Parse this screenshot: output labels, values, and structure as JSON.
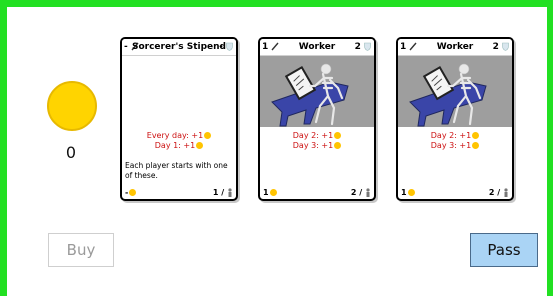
{
  "player": {
    "coins": "0"
  },
  "cards": [
    {
      "left_label": "-",
      "title": "Sorcerer's Stipend",
      "right_label": "-",
      "effects": [
        {
          "text": "Every day: +1"
        },
        {
          "text": "Day 1: +1"
        }
      ],
      "description": "Each player starts with one of these.",
      "cost_label": "-",
      "count": "1 /"
    },
    {
      "left_label": "1",
      "title": "Worker",
      "right_label": "2",
      "effects": [
        {
          "text": "Day 2: +1"
        },
        {
          "text": "Day 3: +1"
        }
      ],
      "description": "",
      "cost_label": "1",
      "count": "2 /"
    },
    {
      "left_label": "1",
      "title": "Worker",
      "right_label": "2",
      "effects": [
        {
          "text": "Day 2: +1"
        },
        {
          "text": "Day 3: +1"
        }
      ],
      "description": "",
      "cost_label": "1",
      "count": "2 /"
    }
  ],
  "buttons": {
    "buy": "Buy",
    "pass": "Pass"
  },
  "colors": {
    "frame": "#22e022",
    "coin": "#ffd400",
    "effect_text": "#cc1111",
    "pass_button": "#aad4f5"
  }
}
